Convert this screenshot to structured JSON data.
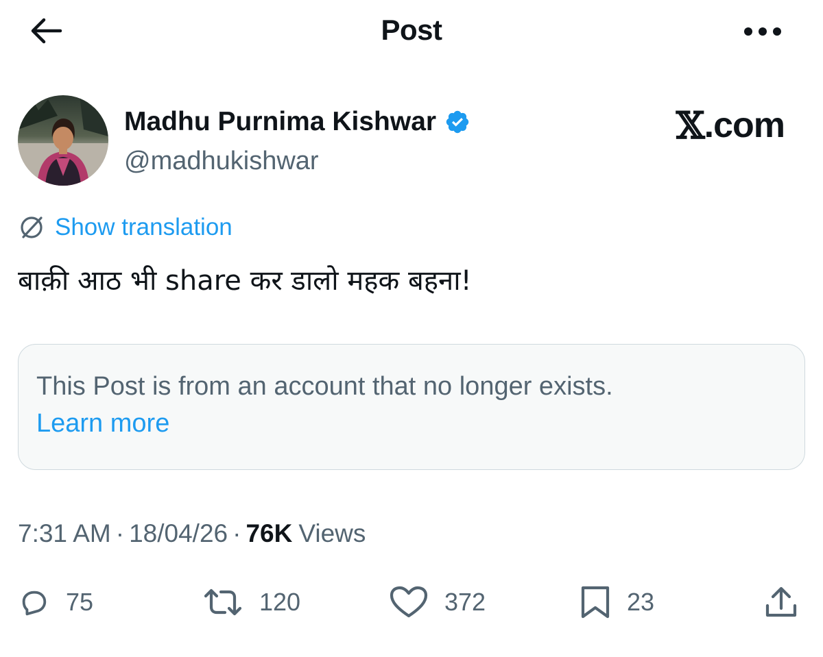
{
  "header": {
    "title": "Post",
    "back_icon": "arrow-left-icon",
    "more_icon": "more-horizontal-icon"
  },
  "author": {
    "name": "Madhu Purnima Kishwar",
    "handle": "@madhukishwar",
    "verified": true,
    "verified_color": "#1d9bf0"
  },
  "brand": {
    "logo": "𝕏",
    "suffix": ".com"
  },
  "translation": {
    "label": "Show translation",
    "icon": "translate-icon"
  },
  "post": {
    "text": "बाक़ी आठ भी share कर डालो महक बहना!"
  },
  "notice": {
    "text": "This Post is from an account that no longer exists.",
    "link": "Learn more"
  },
  "meta": {
    "time": "7:31 AM",
    "separator": "·",
    "date": "18/04/26",
    "views_count": "76K",
    "views_label": "Views"
  },
  "actions": {
    "replies": "75",
    "reposts": "120",
    "likes": "372",
    "bookmarks": "23"
  },
  "colors": {
    "accent": "#1d9bf0",
    "text_primary": "#0f1419",
    "text_secondary": "#536471",
    "notice_bg": "#f7f9f9",
    "notice_border": "#cfd9de"
  }
}
